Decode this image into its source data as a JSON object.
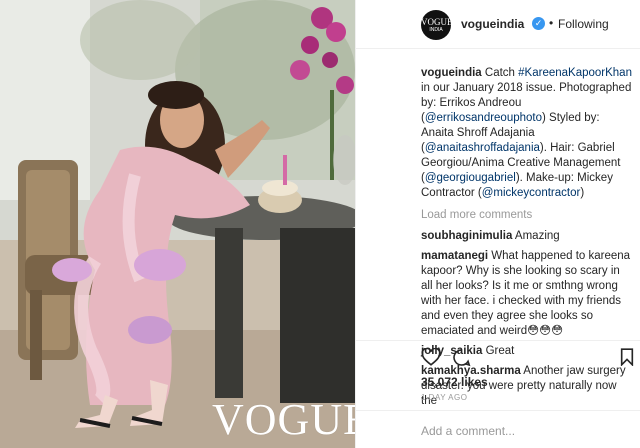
{
  "photo": {
    "alt": "Kareena Kapoor Khan seated at a table in a pink feathered outfit",
    "magazine_mark": "VOGUE"
  },
  "header": {
    "avatar_text_top": "VOGUE",
    "avatar_text_bottom": "INDIA",
    "username": "vogueindia",
    "verified_icon": "verified-badge-icon",
    "separator": "•",
    "follow_state": "Following"
  },
  "caption": {
    "user": "vogueindia",
    "parts": [
      {
        "text": " Catch "
      },
      {
        "text": "#KareenaKapoorKhan",
        "link": true
      },
      {
        "text": " in our January 2018 issue. Photographed by: Errikos Andreou ("
      },
      {
        "text": "@errikosandreouphoto",
        "link": true
      },
      {
        "text": ") Styled by: Anaita Shroff Adajania ("
      },
      {
        "text": "@anaitashroffadajania",
        "link": true
      },
      {
        "text": "). Hair: Gabriel Georgiou/Anima Creative Management ("
      },
      {
        "text": "@georgiougabriel",
        "link": true
      },
      {
        "text": "). Make-up: Mickey Contractor ("
      },
      {
        "text": "@mickeycontractor",
        "link": true
      },
      {
        "text": ")"
      }
    ]
  },
  "load_more": "Load more comments",
  "comments": [
    {
      "user": "soubhaginimulia",
      "text": " Amazing"
    },
    {
      "user": "mamatanegi",
      "text": " What happened to kareena kapoor? Why is she looking so scary in all her looks? Is it me or smthng wrong with her face. i checked with my friends and even they agree she looks so emaciated and weird😳😳😳"
    },
    {
      "user": "jolly_saikia",
      "text": " Great"
    },
    {
      "user": "kamakhya.sharma",
      "text": " Another jaw surgery disaster. you were pretty naturally now the"
    }
  ],
  "actions": {
    "like_icon": "heart-icon",
    "comment_icon": "comment-bubble-icon",
    "save_icon": "bookmark-icon"
  },
  "likes": "35,072 likes",
  "post_date": "1 DAY AGO",
  "add_comment": {
    "placeholder": "Add a comment..."
  },
  "colors": {
    "link": "#003569",
    "verified": "#3897f0",
    "muted": "#999999",
    "text": "#262626",
    "border": "#efefef"
  }
}
